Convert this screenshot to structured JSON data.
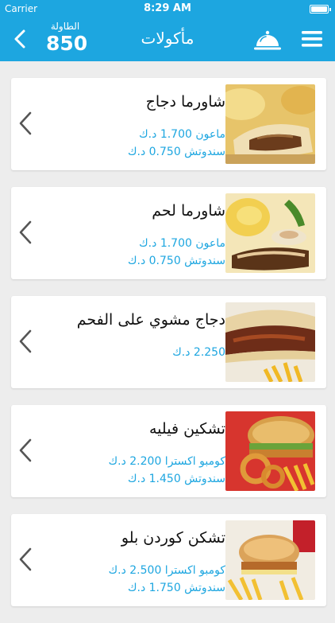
{
  "status_bar": {
    "carrier": "Carrier",
    "time": "8:29 AM"
  },
  "nav": {
    "title": "مأكولات",
    "table_label": "الطاولة",
    "table_number": "850"
  },
  "items": [
    {
      "name": "شاورما دجاج",
      "prices": [
        "ماعون 1.700 د.ك",
        "سندوتش 0.750 د.ك"
      ],
      "image": "chicken-shawarma-photo"
    },
    {
      "name": "شاورما لحم",
      "prices": [
        "ماعون 1.700 د.ك",
        "سندوتش 0.750 د.ك"
      ],
      "image": "meat-shawarma-photo"
    },
    {
      "name": "دجاج مشوي على الفحم",
      "prices": [
        "2.250 د.ك"
      ],
      "image": "grilled-chicken-photo"
    },
    {
      "name": "تشكين فيليه",
      "prices": [
        "كومبو اكسترا 2.200 د.ك",
        "سندوتش 1.450 د.ك"
      ],
      "image": "chicken-fillet-photo"
    },
    {
      "name": "تشكن كوردن بلو",
      "prices": [
        "كومبو اكسترا 2.500 د.ك",
        "سندوتش 1.750 د.ك"
      ],
      "image": "chicken-cordon-bleu-photo"
    }
  ]
}
